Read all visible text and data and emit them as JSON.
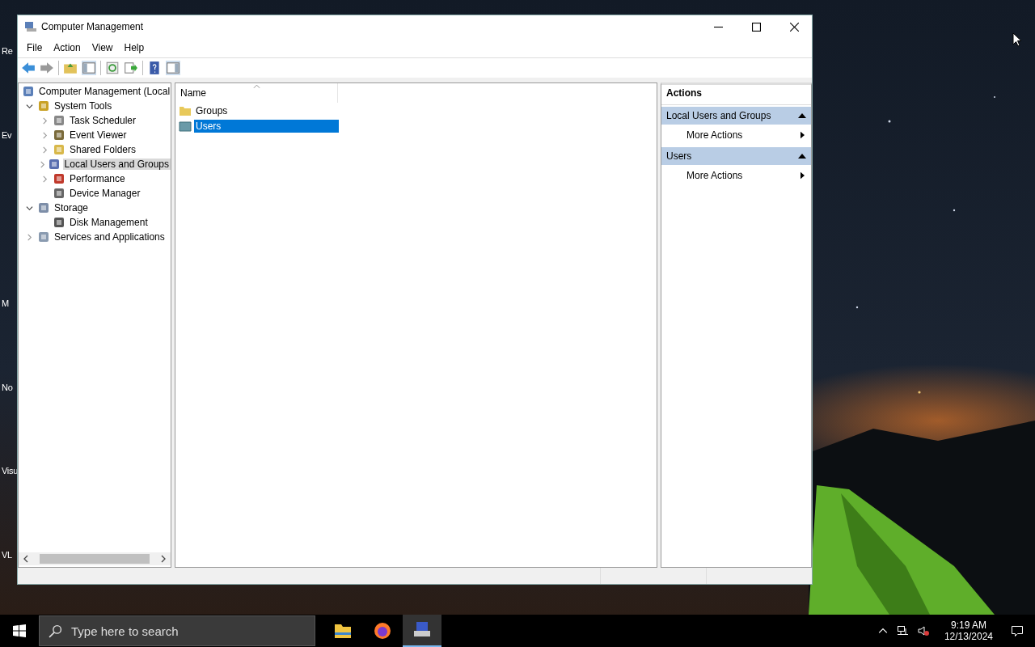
{
  "desktop_icons": [
    {
      "label": "Re"
    },
    {
      "label": "Ev"
    },
    {
      "label": "M"
    },
    {
      "label": "No"
    },
    {
      "label": "Visu"
    },
    {
      "label": "VL"
    }
  ],
  "window": {
    "title": "Computer Management"
  },
  "menu": [
    "File",
    "Action",
    "View",
    "Help"
  ],
  "tree": [
    {
      "label": "Computer Management (Local",
      "selected": false,
      "children": [
        {
          "label": "System Tools",
          "expanded": true,
          "selected": false,
          "children": [
            {
              "label": "Task Scheduler",
              "expanded": false,
              "selected": false
            },
            {
              "label": "Event Viewer",
              "expanded": false,
              "selected": false
            },
            {
              "label": "Shared Folders",
              "expanded": false,
              "selected": false
            },
            {
              "label": "Local Users and Groups",
              "expanded": false,
              "selected": true
            },
            {
              "label": "Performance",
              "expanded": false,
              "selected": false
            },
            {
              "label": "Device Manager",
              "selected": false
            }
          ]
        },
        {
          "label": "Storage",
          "expanded": true,
          "selected": false,
          "children": [
            {
              "label": "Disk Management",
              "selected": false
            }
          ]
        },
        {
          "label": "Services and Applications",
          "expanded": false,
          "selected": false
        }
      ]
    }
  ],
  "list": {
    "columns": [
      "Name"
    ],
    "rows": [
      {
        "name": "Groups",
        "kind": "folder",
        "selected": false
      },
      {
        "name": "Users",
        "kind": "users",
        "selected": true
      }
    ]
  },
  "actions": {
    "title": "Actions",
    "sections": [
      {
        "title": "Local Users and Groups",
        "items": [
          "More Actions"
        ]
      },
      {
        "title": "Users",
        "items": [
          "More Actions"
        ]
      }
    ]
  },
  "taskbar": {
    "search": {
      "placeholder": "Type here to search"
    },
    "apps": [
      {
        "kind": "explorer",
        "selected": false
      },
      {
        "kind": "firefox",
        "selected": false
      },
      {
        "kind": "computer",
        "selected": true
      }
    ],
    "time": "9:19 AM",
    "date": "12/13/2024"
  }
}
